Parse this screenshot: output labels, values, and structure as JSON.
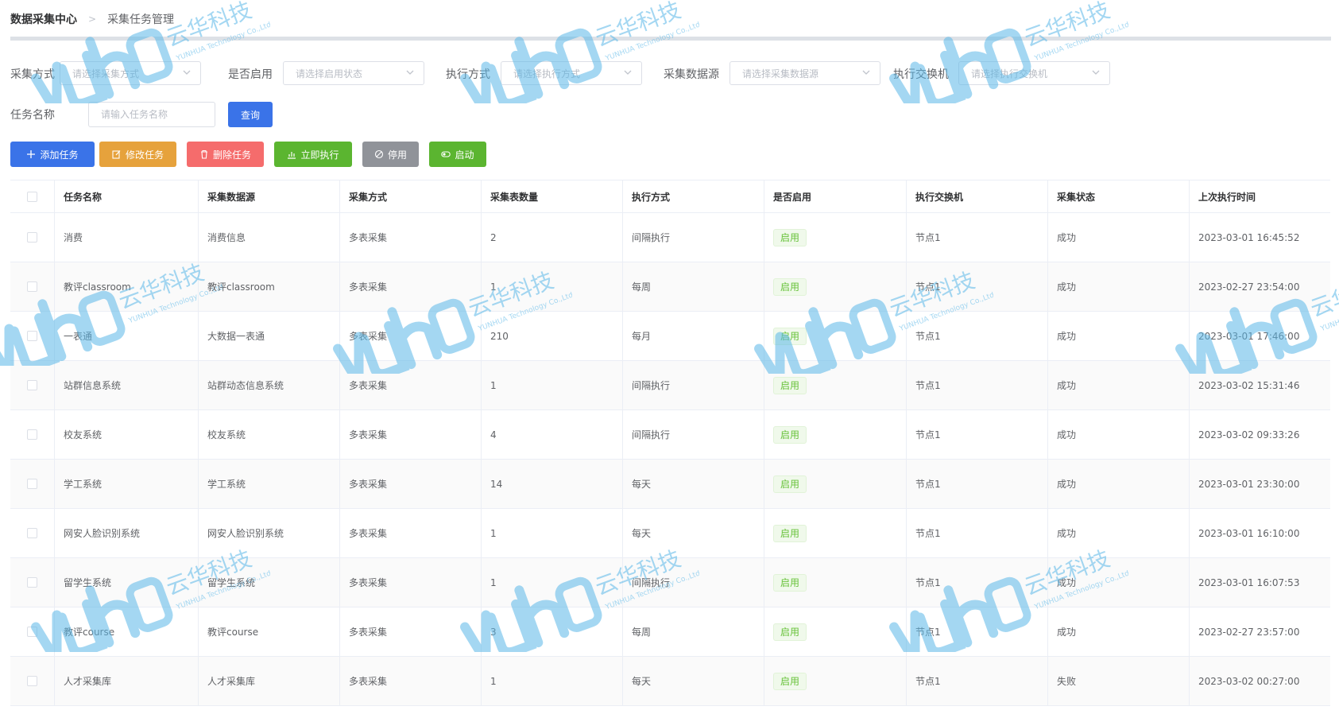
{
  "breadcrumb": {
    "root": "数据采集中心",
    "current": "采集任务管理"
  },
  "filters": {
    "collect_method": {
      "label": "采集方式",
      "placeholder": "请选择采集方式"
    },
    "enabled": {
      "label": "是否启用",
      "placeholder": "请选择启用状态"
    },
    "exec_method": {
      "label": "执行方式",
      "placeholder": "请选择执行方式"
    },
    "datasource": {
      "label": "采集数据源",
      "placeholder": "请选择采集数据源"
    },
    "exchange": {
      "label": "执行交换机",
      "placeholder": "请选择执行交换机"
    },
    "task_name": {
      "label": "任务名称",
      "placeholder": "请输入任务名称",
      "value": ""
    },
    "query_label": "查询"
  },
  "actions": {
    "add": {
      "label": "添加任务",
      "icon": "plus-icon",
      "color": "#3a73e8"
    },
    "edit": {
      "label": "修改任务",
      "icon": "edit-icon",
      "color": "#e6a23c"
    },
    "delete": {
      "label": "删除任务",
      "icon": "trash-icon",
      "color": "#f56c6c"
    },
    "run": {
      "label": "立即执行",
      "icon": "chart-icon",
      "color": "#5bb530"
    },
    "disable": {
      "label": "停用",
      "icon": "circle-slash-icon",
      "color": "#909399"
    },
    "enable": {
      "label": "启动",
      "icon": "toggle-icon",
      "color": "#5bb530"
    }
  },
  "table": {
    "headers": [
      "任务名称",
      "采集数据源",
      "采集方式",
      "采集表数量",
      "执行方式",
      "是否启用",
      "执行交换机",
      "采集状态",
      "上次执行时间"
    ],
    "rows": [
      [
        "消费",
        "消费信息",
        "多表采集",
        "2",
        "间隔执行",
        "启用",
        "节点1",
        "成功",
        "2023-03-01 16:45:52"
      ],
      [
        "教评classroom",
        "教评classroom",
        "多表采集",
        "1",
        "每周",
        "启用",
        "节点1",
        "成功",
        "2023-02-27 23:54:00"
      ],
      [
        "一表通",
        "大数据一表通",
        "多表采集",
        "210",
        "每月",
        "启用",
        "节点1",
        "成功",
        "2023-03-01 17:46:00"
      ],
      [
        "站群信息系统",
        "站群动态信息系统",
        "多表采集",
        "1",
        "间隔执行",
        "启用",
        "节点1",
        "成功",
        "2023-03-02 15:31:46"
      ],
      [
        "校友系统",
        "校友系统",
        "多表采集",
        "4",
        "间隔执行",
        "启用",
        "节点1",
        "成功",
        "2023-03-02 09:33:26"
      ],
      [
        "学工系统",
        "学工系统",
        "多表采集",
        "14",
        "每天",
        "启用",
        "节点1",
        "成功",
        "2023-03-01 23:30:00"
      ],
      [
        "网安人脸识别系统",
        "网安人脸识别系统",
        "多表采集",
        "1",
        "每天",
        "启用",
        "节点1",
        "成功",
        "2023-03-01 16:10:00"
      ],
      [
        "留学生系统",
        "留学生系统",
        "多表采集",
        "1",
        "间隔执行",
        "启用",
        "节点1",
        "成功",
        "2023-03-01 16:07:53"
      ],
      [
        "教评course",
        "教评course",
        "多表采集",
        "3",
        "每周",
        "启用",
        "节点1",
        "成功",
        "2023-02-27 23:57:00"
      ],
      [
        "人才采集库",
        "人才采集库",
        "多表采集",
        "1",
        "每天",
        "启用",
        "节点1",
        "失败",
        "2023-03-02 00:27:00"
      ]
    ]
  },
  "watermark": {
    "brand": "云华科技",
    "sub": "YUNHUA Technology Co.,Ltd",
    "color": "#5bb8e8"
  }
}
